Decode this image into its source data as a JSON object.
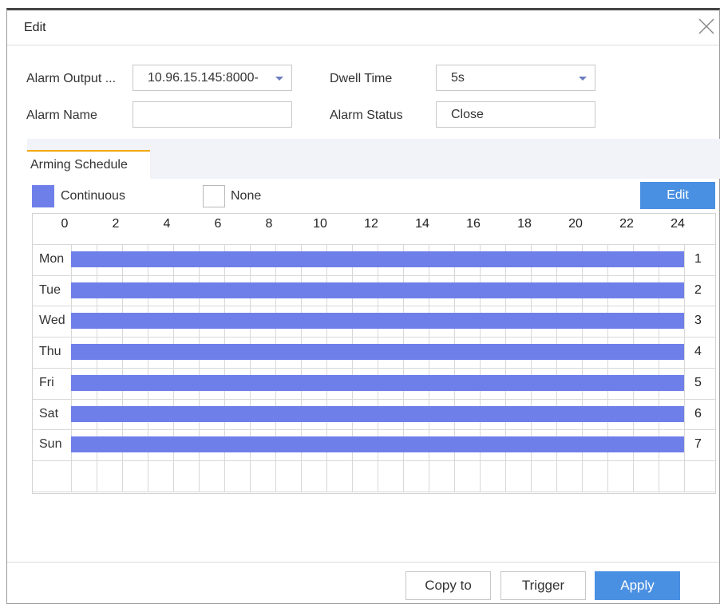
{
  "dialog": {
    "title": "Edit"
  },
  "form": {
    "alarm_output_label": "Alarm Output ...",
    "alarm_output_value": "10.96.15.145:8000-",
    "dwell_time_label": "Dwell Time",
    "dwell_time_value": "5s",
    "alarm_name_label": "Alarm Name",
    "alarm_name_value": "",
    "alarm_status_label": "Alarm Status",
    "alarm_status_value": "Close"
  },
  "tabs": [
    {
      "label": "Arming Schedule",
      "active": true
    }
  ],
  "legend": {
    "continuous": "Continuous",
    "none": "None",
    "continuous_color": "#6f7fea"
  },
  "schedule": {
    "edit_label": "Edit",
    "hours": [
      "0",
      "2",
      "4",
      "6",
      "8",
      "10",
      "12",
      "14",
      "16",
      "18",
      "20",
      "22",
      "24"
    ],
    "days": [
      {
        "label": "Mon",
        "num": "1",
        "mode": "Continuous",
        "start": 0,
        "end": 24
      },
      {
        "label": "Tue",
        "num": "2",
        "mode": "Continuous",
        "start": 0,
        "end": 24
      },
      {
        "label": "Wed",
        "num": "3",
        "mode": "Continuous",
        "start": 0,
        "end": 24
      },
      {
        "label": "Thu",
        "num": "4",
        "mode": "Continuous",
        "start": 0,
        "end": 24
      },
      {
        "label": "Fri",
        "num": "5",
        "mode": "Continuous",
        "start": 0,
        "end": 24
      },
      {
        "label": "Sat",
        "num": "6",
        "mode": "Continuous",
        "start": 0,
        "end": 24
      },
      {
        "label": "Sun",
        "num": "7",
        "mode": "Continuous",
        "start": 0,
        "end": 24
      }
    ]
  },
  "footer": {
    "copy_to": "Copy to",
    "trigger": "Trigger",
    "apply": "Apply"
  },
  "colors": {
    "accent": "#4a90e2",
    "tab_indicator": "#f3a712"
  }
}
